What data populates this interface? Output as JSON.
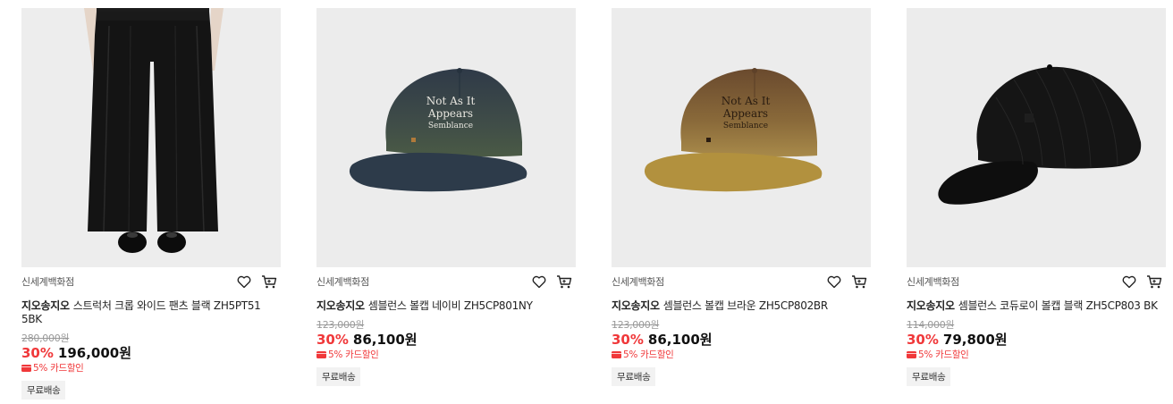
{
  "products": [
    {
      "store": "신세계백화점",
      "brand": "지오송지오",
      "name": "스트럭처 크롭 와이드 팬츠 블랙 ZH5PT51 5BK",
      "original_price": "280,000원",
      "discount": "30%",
      "price": "196,000원",
      "card_discount": "5% 카드할인",
      "shipping": "무료배송",
      "image": "black-wide-pants"
    },
    {
      "store": "신세계백화점",
      "brand": "지오송지오",
      "name": "셈블런스 볼캡 네이비 ZH5CP801NY",
      "original_price": "123,000원",
      "discount": "30%",
      "price": "86,100원",
      "card_discount": "5% 카드할인",
      "shipping": "무료배송",
      "image": "navy-ballcap",
      "cap_print": [
        "Not As It",
        "Appears",
        "Semblance"
      ]
    },
    {
      "store": "신세계백화점",
      "brand": "지오송지오",
      "name": "셈블런스 볼캡 브라운 ZH5CP802BR",
      "original_price": "123,000원",
      "discount": "30%",
      "price": "86,100원",
      "card_discount": "5% 카드할인",
      "shipping": "무료배송",
      "image": "brown-ballcap",
      "cap_print": [
        "Not As It",
        "Appears",
        "Semblance"
      ]
    },
    {
      "store": "신세계백화점",
      "brand": "지오송지오",
      "name": "셈블런스 코듀로이 볼캡 블랙 ZH5CP803 BK",
      "original_price": "114,000원",
      "discount": "30%",
      "price": "79,800원",
      "card_discount": "5% 카드할인",
      "shipping": "무료배송",
      "image": "black-corduroy-ballcap"
    }
  ],
  "icons": {
    "wishlist": "heart-icon",
    "cart": "cart-icon",
    "card": "credit-card-icon"
  },
  "colors": {
    "discount": "#f0383a",
    "thumb_bg": "#ececec",
    "badge_bg": "#f2f2f2"
  }
}
